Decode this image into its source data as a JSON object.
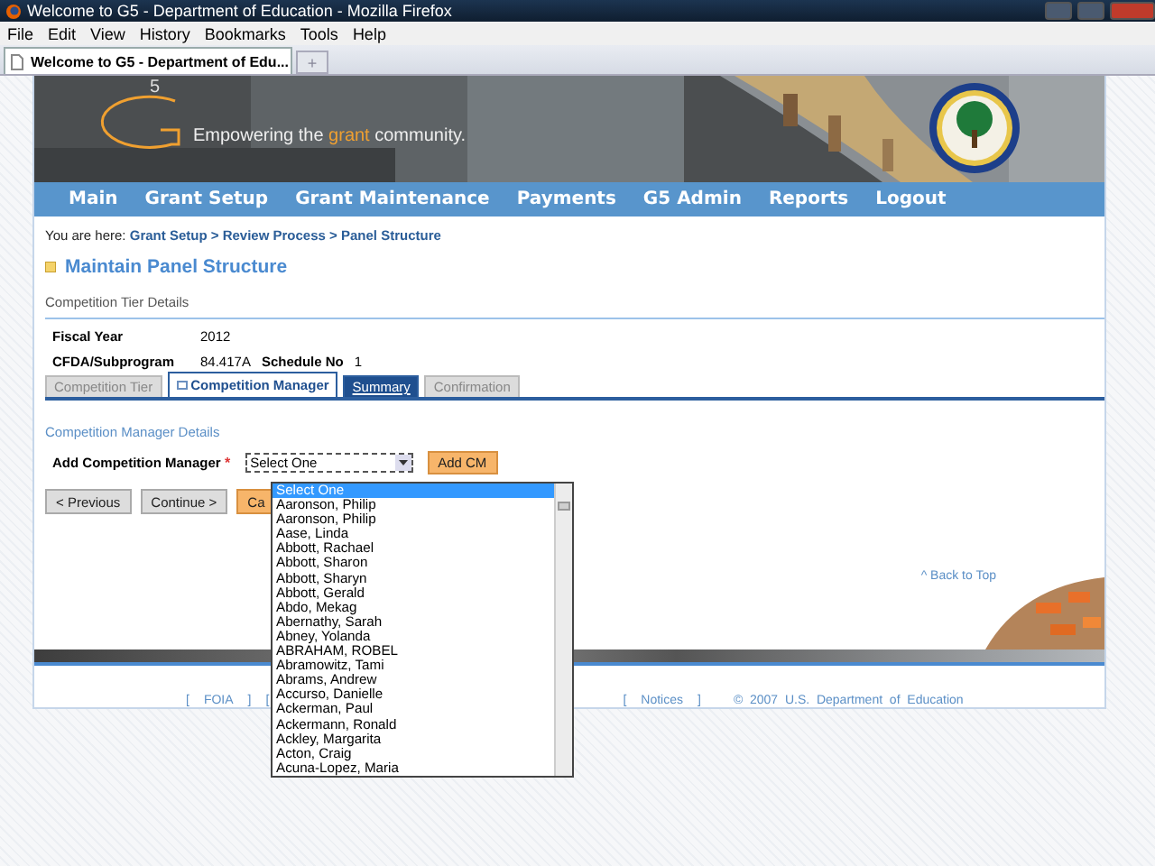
{
  "window": {
    "title": "Welcome to G5 - Department of Education - Mozilla Firefox"
  },
  "menu": [
    "File",
    "Edit",
    "View",
    "History",
    "Bookmarks",
    "Tools",
    "Help"
  ],
  "browser_tabs": [
    {
      "label": "Welcome to G5 - Department of Edu...",
      "selected": true
    }
  ],
  "new_tab": "+",
  "banner": {
    "logo_superscript": "5",
    "tagline": {
      "before": "Empowering the",
      "highlight": "grant",
      "after": "community."
    }
  },
  "nav": [
    "Main",
    "Grant Setup",
    "Grant Maintenance",
    "Payments",
    "G5 Admin",
    "Reports",
    "Logout"
  ],
  "breadcrumb": {
    "prefix": "You are here:",
    "path": "Grant Setup > Review Process > Panel Structure"
  },
  "page_title": "Maintain Panel Structure",
  "tier_section": "Competition Tier Details",
  "fields": [
    {
      "label": "Fiscal Year",
      "value": "2012"
    },
    {
      "label": "CFDA/Subprogram",
      "value": "84.417A",
      "extra_label": "Schedule No",
      "extra_value": "1"
    }
  ],
  "tabs": [
    {
      "label": "Competition Tier",
      "selected": false,
      "disabled": true
    },
    {
      "label": "Competition Manager",
      "selected": true,
      "disabled": false
    },
    {
      "label": "Summary",
      "selected": false,
      "disabled": false
    },
    {
      "label": "Confirmation",
      "selected": false,
      "disabled": true
    }
  ],
  "manager_section": "Competition Manager Details",
  "add_manager": {
    "label": "Add Competition Manager",
    "required": "*",
    "value": "Select One",
    "button": "Add CM"
  },
  "buttons": [
    "< Previous",
    "Continue >",
    "Ca"
  ],
  "dropdown_options": [
    {
      "label": "Select One",
      "selected": true
    },
    {
      "label": "Aaronson, Philip",
      "selected": false
    },
    {
      "label": "Aaronson, Philip",
      "selected": false
    },
    {
      "label": "Aase, Linda",
      "selected": false
    },
    {
      "label": "Abbott, Rachael",
      "selected": false
    },
    {
      "label": "Abbott, Sharon",
      "selected": false
    },
    {
      "label": "Abbott, Sharyn",
      "selected": false
    },
    {
      "label": "Abbott, Gerald",
      "selected": false
    },
    {
      "label": "Abdo, Mekag",
      "selected": false
    },
    {
      "label": "Abernathy, Sarah",
      "selected": false
    },
    {
      "label": "Abney, Yolanda",
      "selected": false
    },
    {
      "label": "ABRAHAM, ROBEL",
      "selected": false
    },
    {
      "label": "Abramowitz, Tami",
      "selected": false
    },
    {
      "label": "Abrams, Andrew",
      "selected": false
    },
    {
      "label": "Accurso, Danielle",
      "selected": false
    },
    {
      "label": "Ackerman, Paul",
      "selected": false
    },
    {
      "label": "Ackermann, Ronald",
      "selected": false
    },
    {
      "label": "Ackley, Margarita",
      "selected": false
    },
    {
      "label": "Acton, Craig",
      "selected": false
    },
    {
      "label": "Acuna-Lopez, Maria",
      "selected": false
    }
  ],
  "back_to_top": "^ Back to Top",
  "footer": {
    "left": [
      "[",
      "FOIA",
      "]",
      "["
    ],
    "notices": [
      "[",
      "Notices",
      "]"
    ],
    "copyright": "©  2007  U.S.  Department  of  Education"
  }
}
